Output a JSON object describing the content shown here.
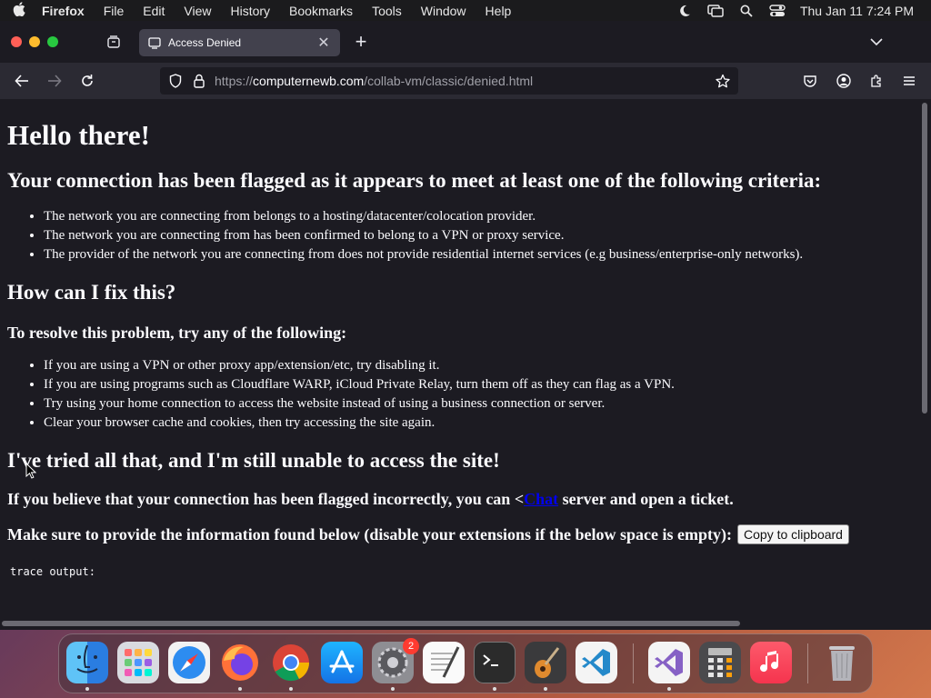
{
  "menubar": {
    "app_name": "Firefox",
    "items": [
      "File",
      "Edit",
      "View",
      "History",
      "Bookmarks",
      "Tools",
      "Window",
      "Help"
    ],
    "clock": "Thu Jan 11  7:24 PM"
  },
  "tab": {
    "title": "Access Denied",
    "close_label": "✕"
  },
  "urlbar": {
    "scheme": "https://",
    "host": "computernewb.com",
    "path": "/collab-vm/classic/denied.html"
  },
  "page": {
    "heading": "Hello there!",
    "criteria_heading": "Your connection has been flagged as it appears to meet at least one of the following criteria:",
    "criteria": [
      "The network you are connecting from belongs to a hosting/datacenter/colocation provider.",
      "The network you are connecting from has been confirmed to belong to a VPN or proxy service.",
      "The provider of the network you are connecting from does not provide residential internet services (e.g business/enterprise-only networks)."
    ],
    "fix_heading": "How can I fix this?",
    "resolve_heading": "To resolve this problem, try any of the following:",
    "fixes": [
      "If you are using a VPN or other proxy app/extension/etc, try disabling it.",
      "If you are using programs such as Cloudflare WARP, iCloud Private Relay, turn them off as they can flag as a VPN.",
      "Try using your home connection to access the website instead of using a business connection or server.",
      "Clear your browser cache and cookies, then try accessing the site again."
    ],
    "tried_heading": "I've tried all that, and I'm still unable to access the site!",
    "flagged_before": "If you believe that your connection has been flagged incorrectly, you can <",
    "flagged_link": "Chat",
    "flagged_after": " server and open a ticket.",
    "info_text": "Make sure to provide the information found below (disable your extensions if the below space is empty):",
    "copy_button": "Copy to clipboard",
    "trace_label": "trace output:"
  },
  "dock": {
    "settings_badge": "2",
    "apps": [
      "finder-icon",
      "launchpad-icon",
      "safari-icon",
      "firefox-icon",
      "chrome-icon",
      "app-store-icon",
      "system-settings-icon",
      "textedit-icon",
      "terminal-icon",
      "garageband-icon",
      "vscode-icon",
      "visual-studio-icon",
      "calculator-icon",
      "music-icon",
      "trash-icon"
    ]
  }
}
